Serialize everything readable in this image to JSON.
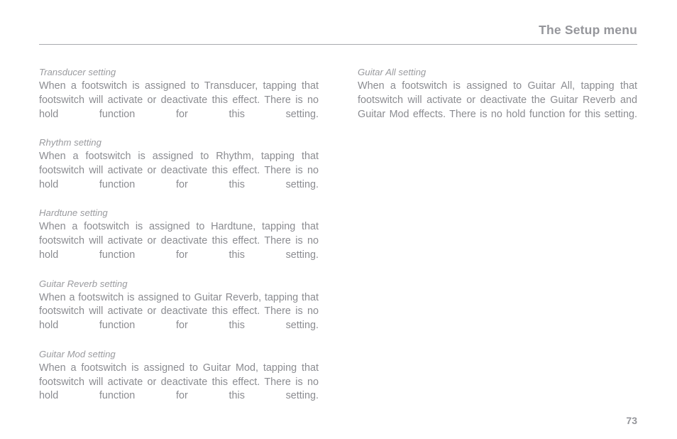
{
  "header": {
    "title": "The Setup menu"
  },
  "columns": {
    "left": [
      {
        "heading": "Transducer setting",
        "body": "When a footswitch is assigned to Transducer, tapping that footswitch will activate or deactivate this effect. There is no hold function for this setting."
      },
      {
        "heading": "Rhythm setting",
        "body": "When a footswitch is assigned to Rhythm, tapping that footswitch will activate or deactivate this effect. There is no hold function for this setting."
      },
      {
        "heading": "Hardtune setting",
        "body": "When a footswitch is assigned to Hardtune, tapping that footswitch will activate or deactivate this effect. There is no hold function for this setting."
      },
      {
        "heading": "Guitar Reverb setting",
        "body": "When a footswitch is assigned to Guitar Reverb, tapping that footswitch will activate or deactivate this effect. There is no hold function for this setting."
      },
      {
        "heading": "Guitar Mod setting",
        "body": "When a footswitch is assigned to Guitar Mod, tapping that footswitch will activate or deactivate this effect. There is no hold function for this setting."
      }
    ],
    "right": [
      {
        "heading": "Guitar All setting",
        "body": "When a footswitch is assigned to Guitar All, tapping that footswitch will activate or deactivate the Guitar Reverb and Guitar Mod effects. There is no hold function for this setting."
      }
    ]
  },
  "footer": {
    "page_number": "73"
  },
  "colors": {
    "header_text": "#95969b",
    "rule": "#a9aaae",
    "heading_text": "#9a9b9f",
    "body_text": "#8b8c91",
    "page_background": "#ffffff"
  }
}
